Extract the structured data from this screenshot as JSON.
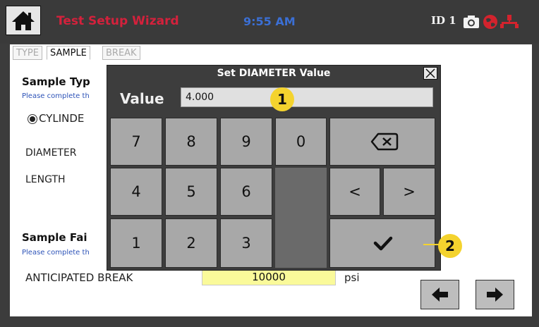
{
  "header": {
    "title": "Test Setup Wizard",
    "time": "9:55 AM",
    "id_label": "ID 1"
  },
  "tabs": [
    "TYPE",
    "SAMPLE",
    "BREAK"
  ],
  "sample_type": {
    "heading": "Sample Typ",
    "hint": "Please complete th",
    "option": "CYLINDE",
    "diameter_label": "DIAMETER",
    "length_label": "LENGTH"
  },
  "sample_failure": {
    "heading": "Sample Fai",
    "hint": "Please complete th",
    "break_label": "ANTICIPATED BREAK",
    "break_value": "10000",
    "unit": "psi"
  },
  "dialog": {
    "title": "Set DIAMETER Value",
    "value_label": "Value",
    "value": "4.000",
    "keys": {
      "k7": "7",
      "k8": "8",
      "k9": "9",
      "k0": "0",
      "k4": "4",
      "k5": "5",
      "k6": "6",
      "k1": "1",
      "k2": "2",
      "k3": "3",
      "left": "<",
      "right": ">"
    }
  },
  "callouts": [
    "1",
    "2"
  ],
  "colors": {
    "title": "#d4213c",
    "time": "#3b6fd4",
    "highlight_field": "#fafa9a",
    "callout": "#f4d32e"
  }
}
